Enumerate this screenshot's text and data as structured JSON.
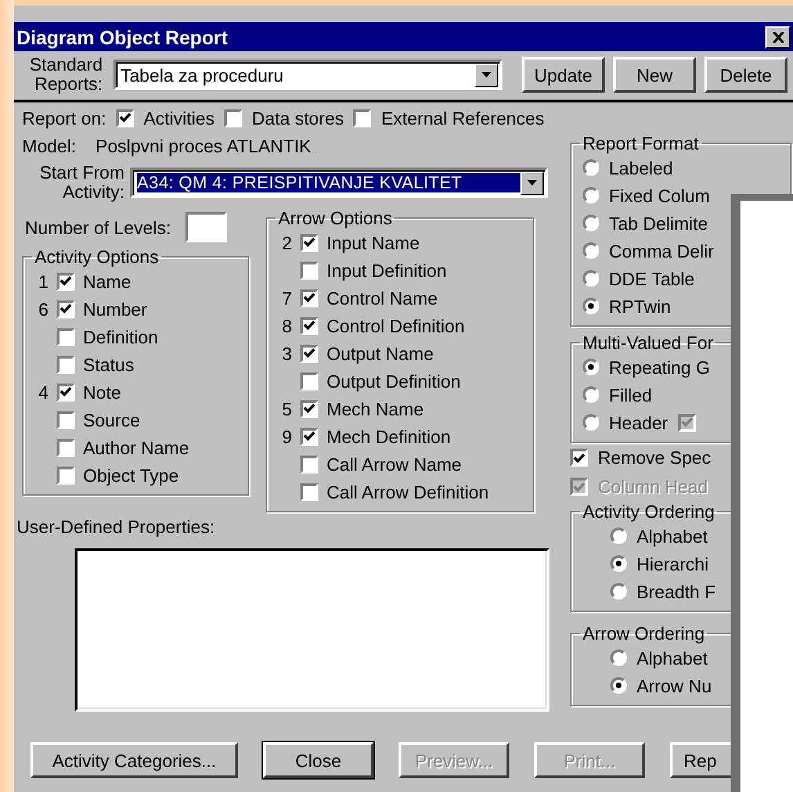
{
  "window": {
    "title": "Diagram Object Report"
  },
  "standard_reports": {
    "label": "Standard Reports:",
    "value": "Tabela za proceduru"
  },
  "top_buttons": [
    {
      "label": "Update"
    },
    {
      "label": "New"
    },
    {
      "label": "Delete"
    }
  ],
  "report_on": {
    "label": "Report on:",
    "options": [
      {
        "label": "Activities",
        "checked": true
      },
      {
        "label": "Data stores",
        "checked": false
      },
      {
        "label": "External References",
        "checked": false
      }
    ]
  },
  "model": {
    "label": "Model:",
    "value": "Poslpvni proces ATLANTIK"
  },
  "start_from": {
    "label": "Start From Activity:",
    "value": "A34:  QM 4:  PREISPITIVANJE KVALITET"
  },
  "number_of_levels": {
    "label": "Number of Levels:"
  },
  "activity_options": {
    "title": "Activity Options",
    "items": [
      {
        "order": "1",
        "label": "Name",
        "checked": true
      },
      {
        "order": "6",
        "label": "Number",
        "checked": true
      },
      {
        "label": "Definition",
        "checked": false
      },
      {
        "label": "Status",
        "checked": false
      },
      {
        "order": "4",
        "label": "Note",
        "checked": true
      },
      {
        "label": "Source",
        "checked": false
      },
      {
        "label": "Author Name",
        "checked": false
      },
      {
        "label": "Object Type",
        "checked": false
      }
    ]
  },
  "arrow_options": {
    "title": "Arrow Options",
    "items": [
      {
        "order": "2",
        "label": "Input Name",
        "checked": true
      },
      {
        "label": "Input Definition",
        "checked": false
      },
      {
        "order": "7",
        "label": "Control Name",
        "checked": true
      },
      {
        "order": "8",
        "label": "Control Definition",
        "checked": true
      },
      {
        "order": "3",
        "label": "Output Name",
        "checked": true
      },
      {
        "label": "Output Definition",
        "checked": false
      },
      {
        "order": "5",
        "label": "Mech Name",
        "checked": true
      },
      {
        "order": "9",
        "label": "Mech Definition",
        "checked": true
      },
      {
        "label": "Call Arrow Name",
        "checked": false
      },
      {
        "label": "Call Arrow Definition",
        "checked": false
      }
    ]
  },
  "user_defined_properties": {
    "label": "User-Defined Properties:"
  },
  "report_format": {
    "title": "Report Format",
    "options": [
      {
        "label": "Labeled",
        "selected": false
      },
      {
        "label": "Fixed Colum",
        "selected": false
      },
      {
        "label": "Tab Delimite",
        "selected": false
      },
      {
        "label": "Comma Delir",
        "selected": false
      },
      {
        "label": "DDE Table",
        "selected": false
      },
      {
        "label": "RPTwin",
        "selected": true
      }
    ]
  },
  "multi_valued": {
    "title": "Multi-Valued For",
    "options": [
      {
        "label": "Repeating G",
        "selected": true
      },
      {
        "label": "Filled",
        "selected": false
      },
      {
        "label": "Header",
        "selected": false,
        "box_checked": true,
        "box_disabled": true
      }
    ]
  },
  "report_checks": [
    {
      "label": "Remove Spec",
      "checked": true,
      "disabled": false
    },
    {
      "label": "Column Head",
      "checked": true,
      "disabled": true
    }
  ],
  "activity_ordering": {
    "title": "Activity Ordering",
    "options": [
      {
        "label": "Alphabet",
        "selected": false
      },
      {
        "label": "Hierarchi",
        "selected": true
      },
      {
        "label": "Breadth F",
        "selected": false
      }
    ]
  },
  "arrow_ordering": {
    "title": "Arrow Ordering",
    "options": [
      {
        "label": "Alphabet",
        "selected": false
      },
      {
        "label": "Arrow Nu",
        "selected": true
      }
    ]
  },
  "bottom_buttons": [
    {
      "label": "Activity Categories...",
      "disabled": false,
      "default": false
    },
    {
      "label": "Close",
      "disabled": false,
      "default": true
    },
    {
      "label": "Preview...",
      "disabled": true,
      "default": false
    },
    {
      "label": "Print...",
      "disabled": true,
      "default": false
    },
    {
      "label": "Rep",
      "disabled": false,
      "default": false
    }
  ]
}
